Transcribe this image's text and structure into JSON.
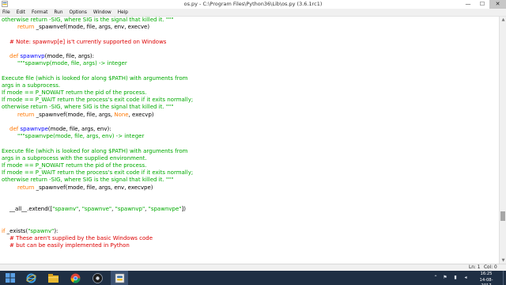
{
  "window": {
    "title": "os.py - C:\\Program Files\\Python36\\Lib\\os.py (3.6.1rc1)",
    "minimize": "—",
    "maximize": "☐",
    "close": "✕"
  },
  "menubar": [
    "File",
    "Edit",
    "Format",
    "Run",
    "Options",
    "Window",
    "Help"
  ],
  "editor": {
    "lines": [
      {
        "text": "otherwise return -SIG, where SIG is the signal that killed it. \"\"\"",
        "color": "green",
        "indent": 0
      },
      {
        "text": "return _spawnvef(mode, file, args, env, execve)",
        "color": "black",
        "indent": 2,
        "keyword": "return"
      },
      {
        "text": "",
        "color": "black",
        "indent": 0
      },
      {
        "text": "# Note: spawnvp[e] is't currently supported on Windows",
        "color": "red",
        "indent": 1
      },
      {
        "text": "",
        "color": "black",
        "indent": 0
      },
      {
        "text": "def spawnvp(mode, file, args):",
        "color": "black",
        "indent": 1,
        "keyword": "def",
        "defname": "spawnvp"
      },
      {
        "text": "\"\"\"spawnvp(mode, file, args) -> integer",
        "color": "green",
        "indent": 2
      },
      {
        "text": "",
        "color": "black",
        "indent": 0
      },
      {
        "text": "Execute file (which is looked for along $PATH) with arguments from",
        "color": "green",
        "indent": 0
      },
      {
        "text": "args in a subprocess.",
        "color": "green",
        "indent": 0
      },
      {
        "text": "If mode == P_NOWAIT return the pid of the process.",
        "color": "green",
        "indent": 0
      },
      {
        "text": "If mode == P_WAIT return the process's exit code if it exits normally;",
        "color": "green",
        "indent": 0
      },
      {
        "text": "otherwise return -SIG, where SIG is the signal that killed it. \"\"\"",
        "color": "green",
        "indent": 0
      },
      {
        "text": "return _spawnvef(mode, file, args, None, execvp)",
        "color": "black",
        "indent": 2,
        "keyword": "return",
        "builtin": "None"
      },
      {
        "text": "",
        "color": "black",
        "indent": 0
      },
      {
        "text": "def spawnvpe(mode, file, args, env):",
        "color": "black",
        "indent": 1,
        "keyword": "def",
        "defname": "spawnvpe"
      },
      {
        "text": "\"\"\"spawnvpe(mode, file, args, env) -> integer",
        "color": "green",
        "indent": 2
      },
      {
        "text": "",
        "color": "black",
        "indent": 0
      },
      {
        "text": "Execute file (which is looked for along $PATH) with arguments from",
        "color": "green",
        "indent": 0
      },
      {
        "text": "args in a subprocess with the supplied environment.",
        "color": "green",
        "indent": 0
      },
      {
        "text": "If mode == P_NOWAIT return the pid of the process.",
        "color": "green",
        "indent": 0
      },
      {
        "text": "If mode == P_WAIT return the process's exit code if it exits normally;",
        "color": "green",
        "indent": 0
      },
      {
        "text": "otherwise return -SIG, where SIG is the signal that killed it. \"\"\"",
        "color": "green",
        "indent": 0
      },
      {
        "text": "return _spawnvef(mode, file, args, env, execvpe)",
        "color": "black",
        "indent": 2,
        "keyword": "return"
      },
      {
        "text": "",
        "color": "black",
        "indent": 0
      },
      {
        "text": "",
        "color": "black",
        "indent": 0
      },
      {
        "text": "__all__.extend([\"spawnv\", \"spawnve\", \"spawnvp\", \"spawnvpe\"])",
        "color": "black",
        "indent": 1,
        "string_args": true
      },
      {
        "text": "",
        "color": "black",
        "indent": 0
      },
      {
        "text": "",
        "color": "black",
        "indent": 0
      },
      {
        "text": "if _exists(\"spawnv\"):",
        "color": "black",
        "indent": 0,
        "keyword": "if"
      },
      {
        "text": "# These aren't supplied by the basic Windows code",
        "color": "red",
        "indent": 1
      },
      {
        "text": "# but can be easily implemented in Python",
        "color": "red",
        "indent": 1
      }
    ]
  },
  "statusbar": {
    "line": "Ln: 1",
    "col": "Col: 0"
  },
  "taskbar": {
    "time": "16:25",
    "date": "14-08-2017",
    "apps": [
      "start-icon",
      "ie-icon",
      "file-explorer-icon",
      "chrome-icon",
      "media-icon",
      "python-idle-icon"
    ]
  },
  "colors": {
    "comment_red": "#dd0000",
    "string_green": "#00aa00",
    "keyword_orange": "#ff7700",
    "def_blue": "#0000ff",
    "builtin_purple": "#900090",
    "taskbar": "#1f2f44"
  }
}
